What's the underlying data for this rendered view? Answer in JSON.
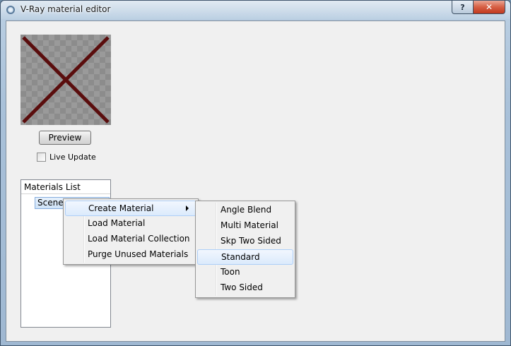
{
  "window": {
    "title": "V-Ray material editor",
    "help_symbol": "?",
    "close_symbol": "✕",
    "app_icon": "vray-icon"
  },
  "preview": {
    "swatch_icon": "no-material-x",
    "button_label": "Preview",
    "live_update_label": "Live Update",
    "live_update_checked": false
  },
  "materials": {
    "header": "Materials List",
    "scene_item": "Scene Materials"
  },
  "context_menu": {
    "items": [
      {
        "label": "Create Material",
        "has_submenu": true,
        "highlighted": true
      },
      {
        "label": "Load Material"
      },
      {
        "label": "Load Material Collection"
      },
      {
        "label": "Purge Unused Materials"
      }
    ]
  },
  "submenu": {
    "items": [
      {
        "label": "Angle Blend"
      },
      {
        "label": "Multi Material"
      },
      {
        "label": "Skp Two Sided"
      },
      {
        "label": "Standard",
        "highlighted": true
      },
      {
        "label": "Toon"
      },
      {
        "label": "Two Sided"
      }
    ]
  },
  "colors": {
    "cross": "#5a0d0d",
    "highlight_border": "#aecff7",
    "close_button": "#c94a2e"
  }
}
